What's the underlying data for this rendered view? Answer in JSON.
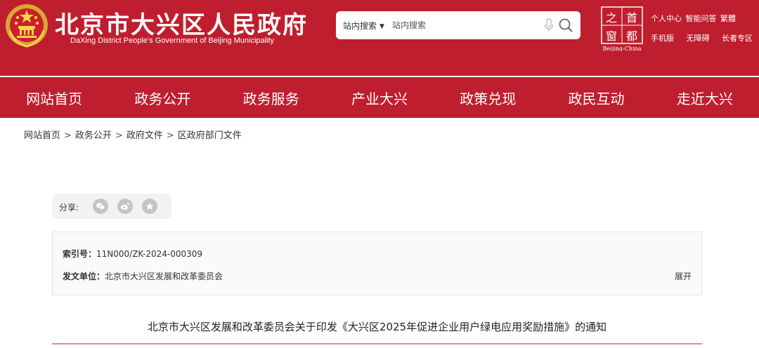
{
  "header": {
    "title": "北京市大兴区人民政府",
    "subtitle": "DaXing District People's Government of Beijing Municipality",
    "capital_logo_text": "Beijing-China",
    "capital_logo_chars": [
      "首",
      "都",
      "之",
      "窗"
    ],
    "toplinks": [
      "个人中心",
      "智能问答",
      "繁體"
    ],
    "toplinks_row2": [
      "手机版",
      "无障碍",
      "长者专区"
    ]
  },
  "search": {
    "scope": "站内搜索",
    "placeholder": "站内搜索"
  },
  "nav": [
    "网站首页",
    "政务公开",
    "政务服务",
    "产业大兴",
    "政策兑现",
    "政民互动",
    "走近大兴"
  ],
  "breadcrumb": [
    "网站首页",
    "政务公开",
    "政府文件",
    "区政府部门文件"
  ],
  "breadcrumb_sep": ">",
  "share": {
    "label": "分享:",
    "targets": [
      "wechat-icon",
      "weibo-icon",
      "favorite-icon"
    ]
  },
  "meta": {
    "index_label": "索引号：",
    "index_value": "11N000/ZK-2024-000309",
    "issuer_label": "发文单位：",
    "issuer_value": "北京市大兴区发展和改革委员会",
    "expand_label": "展开"
  },
  "document": {
    "title": "北京市大兴区发展和改革委员会关于印发《大兴区2025年促进企业用户绿电应用奖励措施》的通知"
  },
  "colors": {
    "brand_red": "#bf1e2e",
    "share_bg": "#f2f2f2",
    "divider": "#e08a8a"
  }
}
